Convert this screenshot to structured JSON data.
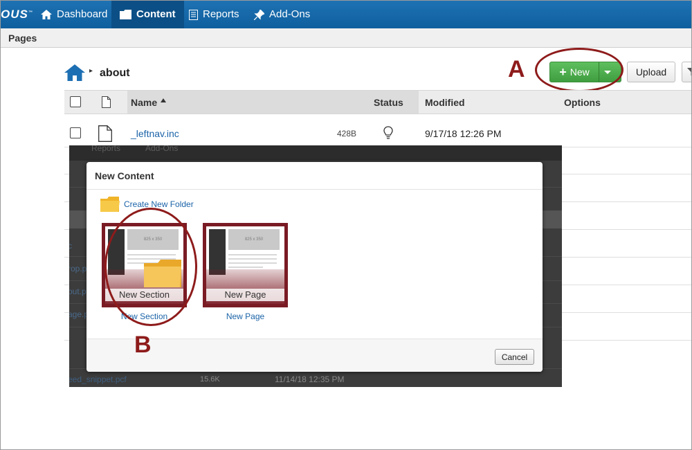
{
  "nav": {
    "logo": "OUS",
    "items": [
      {
        "label": "Dashboard",
        "icon": "home-icon"
      },
      {
        "label": "Content",
        "icon": "folder-icon",
        "active": true
      },
      {
        "label": "Reports",
        "icon": "document-icon"
      },
      {
        "label": "Add-Ons",
        "icon": "pin-icon"
      }
    ]
  },
  "subbar": {
    "title": "Pages"
  },
  "breadcrumb": {
    "current": "about"
  },
  "toolbar": {
    "new_label": "New",
    "upload_label": "Upload"
  },
  "annotations": {
    "a": "A",
    "b": "B"
  },
  "table": {
    "headers": {
      "name": "Name",
      "status": "Status",
      "modified": "Modified",
      "options": "Options"
    },
    "rows": [
      {
        "name": "_leftnav.inc",
        "size": "428B",
        "modified": "9/17/18 12:26 PM"
      }
    ]
  },
  "background_shot": {
    "nav_items": [
      "Reports",
      "Add-Ons"
    ],
    "partial_links": [
      "c",
      "rop.p",
      "out.p",
      "age.p"
    ],
    "bottom_row": {
      "name": "eed_snippet.pcf",
      "size": "15.6K",
      "modified": "11/14/18 12:35 PM"
    }
  },
  "modal": {
    "title": "New Content",
    "create_folder_label": "Create New Folder",
    "tiles": [
      {
        "label": "New Section",
        "caption": "New Section",
        "thumb_text": "825 x 350"
      },
      {
        "label": "New Page",
        "caption": "New Page",
        "thumb_text": "825 x 350"
      }
    ],
    "cancel_label": "Cancel"
  },
  "colors": {
    "nav_blue": "#1e72b3",
    "accent_green": "#4caf50",
    "annotation_red": "#8e1b1b",
    "link_blue": "#1a63a8"
  }
}
